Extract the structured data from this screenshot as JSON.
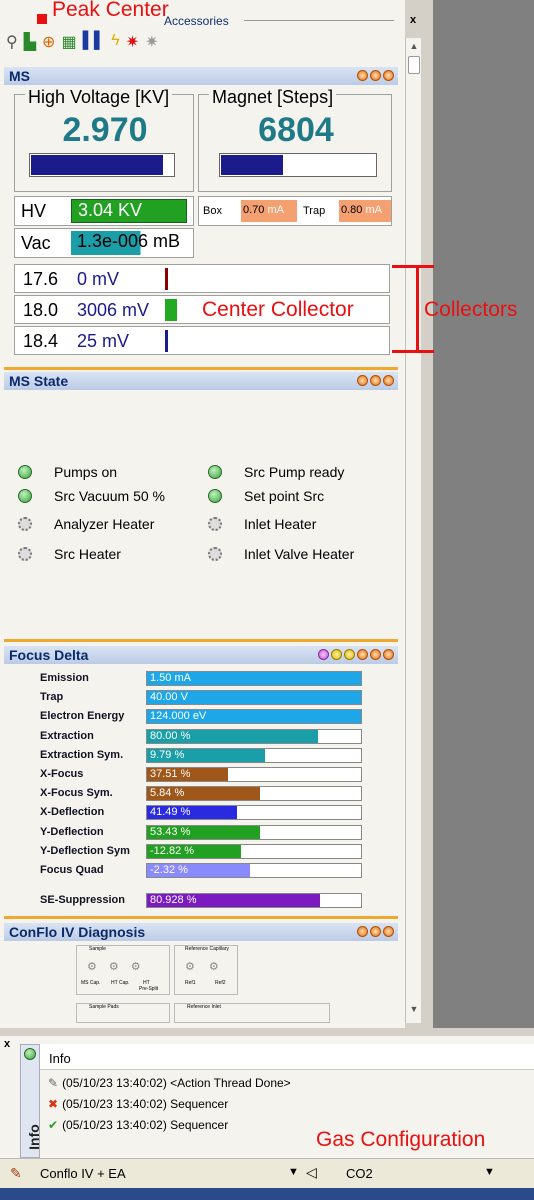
{
  "annotations": {
    "peak_center": "Peak Center",
    "center_collector": "Center Collector",
    "collectors": "Collectors",
    "gas_configuration": "Gas Configuration"
  },
  "accessories": {
    "title": "Accessories",
    "close": "x"
  },
  "ms": {
    "title": "MS",
    "hv_title": "High Voltage [KV]",
    "hv_value": "2.970",
    "hv_level": 0.92,
    "magnet_title": "Magnet [Steps]",
    "magnet_value": "6804",
    "magnet_level": 0.4,
    "hv_label": "HV",
    "hv_readout": "3.04 KV",
    "box_label": "Box",
    "box_value": "0.70",
    "box_unit": "mA",
    "trap_label": "Trap",
    "trap_value": "0.80",
    "trap_unit": "mA",
    "vac_label": "Vac",
    "vac_readout": "1.3e-006 mB",
    "collectors": [
      {
        "mass": "17.6",
        "value": "0 mV",
        "color": "#8b0000"
      },
      {
        "mass": "18.0",
        "value": "3006 mV",
        "color": "#22aa22"
      },
      {
        "mass": "18.4",
        "value": "25 mV",
        "color": "#1b1b8c"
      }
    ]
  },
  "ms_state": {
    "title": "MS State",
    "left": [
      {
        "label": "Pumps on",
        "icon": "led-icon"
      },
      {
        "label": "Src Vacuum 50 %",
        "icon": "led-icon"
      },
      {
        "label": "Analyzer Heater",
        "icon": "gear-icon"
      },
      {
        "label": "Src Heater",
        "icon": "gear-icon"
      }
    ],
    "right": [
      {
        "label": "Src Pump ready",
        "icon": "led-icon"
      },
      {
        "label": "Set point Src",
        "icon": "led-icon"
      },
      {
        "label": "Inlet Heater",
        "icon": "gear-icon"
      },
      {
        "label": "Inlet Valve Heater",
        "icon": "gear-icon"
      }
    ]
  },
  "focus": {
    "title": "Focus Delta",
    "rows": [
      {
        "label": "Emission",
        "value": "1.50 mA",
        "fill": 1.0,
        "color": "#1ea7e8"
      },
      {
        "label": "Trap",
        "value": "40.00 V",
        "fill": 1.0,
        "color": "#1ea7e8"
      },
      {
        "label": "Electron Energy",
        "value": "124.000 eV",
        "fill": 1.0,
        "color": "#1ea7e8"
      },
      {
        "label": "Extraction",
        "value": "80.00 %",
        "fill": 0.8,
        "color": "#1a9fa8"
      },
      {
        "label": "Extraction Sym.",
        "value": "9.79 %",
        "fill": 0.55,
        "color": "#1a9fa8"
      },
      {
        "label": "X-Focus",
        "value": "37.51 %",
        "fill": 0.38,
        "color": "#a0581a"
      },
      {
        "label": "X-Focus Sym.",
        "value": "5.84 %",
        "fill": 0.53,
        "color": "#a0581a"
      },
      {
        "label": "X-Deflection",
        "value": "41.49 %",
        "fill": 0.42,
        "color": "#2a2ae0"
      },
      {
        "label": "Y-Deflection",
        "value": "53.43 %",
        "fill": 0.53,
        "color": "#22a022"
      },
      {
        "label": "Y-Deflection Sym",
        "value": "-12.82 %",
        "fill": 0.44,
        "color": "#22a022"
      },
      {
        "label": "Focus Quad",
        "value": "-2.32 %",
        "fill": 0.48,
        "color": "#8a8aff"
      },
      {
        "label": "SE-Suppression",
        "value": "80.928 %",
        "fill": 0.81,
        "color": "#7a1ac0"
      }
    ]
  },
  "conflo": {
    "title": "ConFlo IV Diagnosis",
    "sample": "Sample",
    "ref_cap": "Reference Capillary",
    "ms_cap": "MS Cap.",
    "ht_cap": "HT Cap.",
    "ht2": "HT",
    "pre_split": "Pre-Split",
    "r1": "Ref1",
    "r2": "Ref2",
    "sample_pads": "Sample Pads",
    "ref_inlet": "Reference Inlet"
  },
  "info": {
    "tab": "Info",
    "title": "Info",
    "logs": [
      {
        "text": "(05/10/23 13:40:02) <Action Thread Done>",
        "icon": "pen-icon"
      },
      {
        "text": "(05/10/23 13:40:02) Sequencer",
        "icon": "error-icon"
      },
      {
        "text": "(05/10/23 13:40:02) Sequencer",
        "icon": "ok-icon"
      }
    ]
  },
  "toolbar": {
    "config": "Conflo IV + EA",
    "gas": "CO2"
  }
}
